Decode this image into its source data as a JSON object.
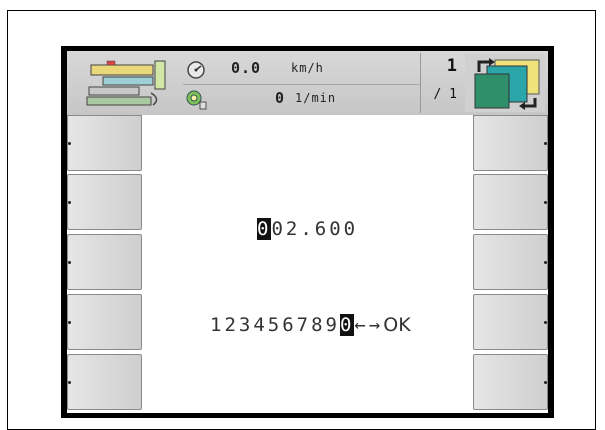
{
  "header": {
    "speed": {
      "value": "0.0",
      "unit": "km/h"
    },
    "rpm": {
      "value": "0",
      "unit": "1/min"
    },
    "page_counter": {
      "current": "1",
      "total": "/ 1"
    }
  },
  "entry": {
    "value_cursor_char": "0",
    "value_rest": "02.600"
  },
  "keypad": {
    "digits": "123456789",
    "selected_key": "0",
    "arrows": "←→",
    "ok": "OK"
  },
  "softkeys": {
    "left": [
      "",
      "",
      "",
      "",
      ""
    ],
    "right": [
      "",
      "",
      "",
      "",
      ""
    ]
  },
  "icons": {
    "machine": "machine-overview-icon",
    "speed_gauge": "speedometer-icon",
    "rpm_gauge": "pto-rpm-icon",
    "mode": "layer-switch-icon"
  }
}
